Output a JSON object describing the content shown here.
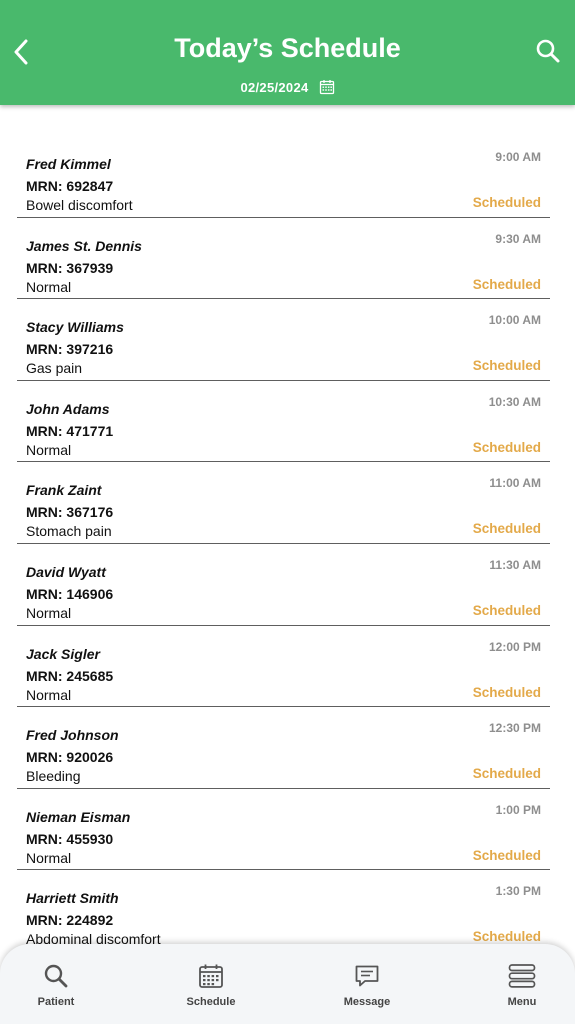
{
  "header": {
    "title": "Today’s Schedule",
    "date": "02/25/2024",
    "back_icon": "chevron-left-icon",
    "search_icon": "search-icon",
    "calendar_icon": "calendar-icon"
  },
  "colors": {
    "header_bg": "#49b96c",
    "status": "#e3a949",
    "time": "#8e8e8e"
  },
  "appointments": [
    {
      "name": "Fred Kimmel",
      "mrn": "MRN: 692847",
      "reason": "Bowel discomfort",
      "time": "9:00 AM",
      "status": "Scheduled"
    },
    {
      "name": "James St. Dennis",
      "mrn": "MRN: 367939",
      "reason": "Normal",
      "time": "9:30 AM",
      "status": "Scheduled"
    },
    {
      "name": "Stacy Williams",
      "mrn": "MRN: 397216",
      "reason": "Gas pain",
      "time": "10:00 AM",
      "status": "Scheduled"
    },
    {
      "name": "John Adams",
      "mrn": "MRN: 471771",
      "reason": "Normal",
      "time": "10:30 AM",
      "status": "Scheduled"
    },
    {
      "name": "Frank Zaint",
      "mrn": "MRN: 367176",
      "reason": "Stomach pain",
      "time": "11:00 AM",
      "status": "Scheduled"
    },
    {
      "name": "David Wyatt",
      "mrn": "MRN: 146906",
      "reason": "Normal",
      "time": "11:30 AM",
      "status": "Scheduled"
    },
    {
      "name": "Jack Sigler",
      "mrn": "MRN: 245685",
      "reason": "Normal",
      "time": "12:00 PM",
      "status": "Scheduled"
    },
    {
      "name": "Fred Johnson",
      "mrn": "MRN: 920026",
      "reason": "Bleeding",
      "time": "12:30 PM",
      "status": "Scheduled"
    },
    {
      "name": "Nieman Eisman",
      "mrn": "MRN: 455930",
      "reason": "Normal",
      "time": "1:00 PM",
      "status": "Scheduled"
    },
    {
      "name": "Harriett Smith",
      "mrn": "MRN: 224892",
      "reason": "Abdominal discomfort",
      "time": "1:30 PM",
      "status": "Scheduled"
    }
  ],
  "tabbar": [
    {
      "label": "Patient",
      "icon": "search-icon"
    },
    {
      "label": "Schedule",
      "icon": "calendar-icon"
    },
    {
      "label": "Message",
      "icon": "message-icon"
    },
    {
      "label": "Menu",
      "icon": "menu-icon"
    }
  ]
}
